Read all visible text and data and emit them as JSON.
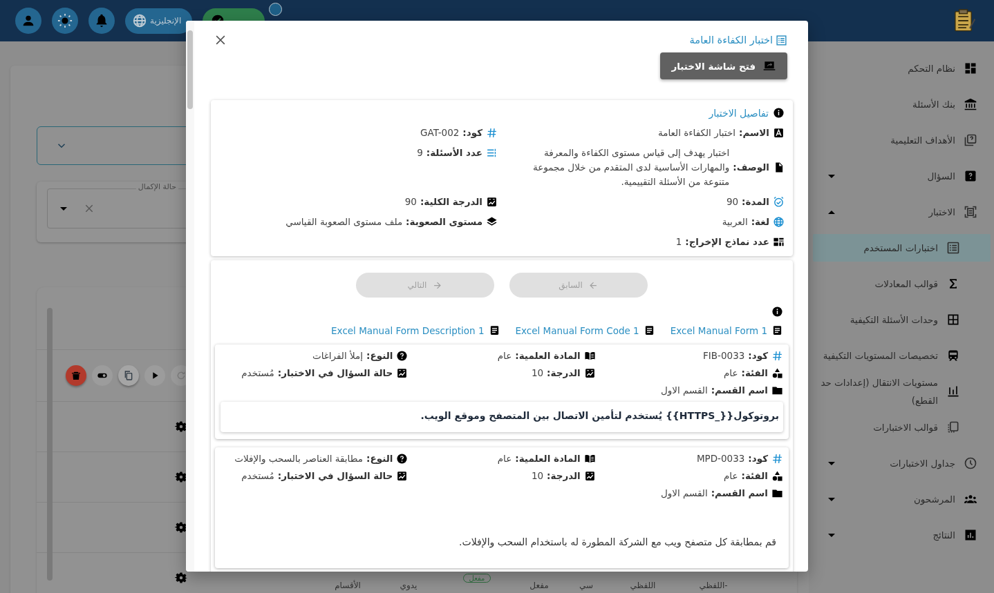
{
  "header": {
    "language": "الإنجليزية"
  },
  "sidebar": {
    "items": [
      {
        "label": "نظام التحكم",
        "selected": false
      },
      {
        "label": "بنك الأسئلة",
        "selected": false
      },
      {
        "label": "الأهداف التعليمية",
        "selected": false
      },
      {
        "label": "السؤال",
        "selected": false,
        "expanded": false
      },
      {
        "label": "الاختبار",
        "selected": false,
        "expanded": true,
        "children": [
          {
            "label": "اختبارات المستخدم",
            "selected": true
          },
          {
            "label": "قوالب المعادلات",
            "selected": false
          },
          {
            "label": "وحدات الأسئلة التكيفية",
            "selected": false
          },
          {
            "label": "تخصيصات المستويات التكيفية",
            "selected": false
          },
          {
            "label": "مستويات الانتقال (إعدادات حد القطع)",
            "selected": false
          },
          {
            "label": "قوالب الاختبارات",
            "selected": false
          }
        ]
      },
      {
        "label": "جداول الاختبارات",
        "selected": false,
        "expanded": false
      },
      {
        "label": "المرشحون",
        "selected": false,
        "expanded": false
      },
      {
        "label": "النتائج",
        "selected": false,
        "expanded": false
      }
    ]
  },
  "background": {
    "filter_label": "حالة الإكمال",
    "table_bottom_row": [
      "-اللفظي",
      "اللفظي",
      "سي",
      "مفعل",
      "مفعل",
      "يدوي",
      "الأقسام"
    ]
  },
  "dialog": {
    "title": "اختبار الكفاءة العامة",
    "open_button": "فتح شاشة الاختبار",
    "details": {
      "heading": "تفاصيل الاختبار",
      "fields": [
        {
          "label": "الاسم:",
          "value": "اختبار الكفاءة العامة"
        },
        {
          "label": "كود:",
          "value": "GAT-002"
        },
        {
          "label": "الوصف:",
          "value": "اختبار يهدف إلى قياس مستوى الكفاءة والمعرفة والمهارات الأساسية لدى المتقدم من خلال مجموعة متنوعة من الأسئلة التقييمية."
        },
        {
          "label": "عدد الأسئلة:",
          "value": "9"
        },
        {
          "label": "المدة:",
          "value": "90"
        },
        {
          "label": "الدرجة الكلية:",
          "value": "90"
        },
        {
          "label": "لغة:",
          "value": "العربية"
        },
        {
          "label": "مستوى الصعوبة:",
          "value": "ملف مستوى الصعوبة القياسي"
        },
        {
          "label": "عدد نماذج الإخراج:",
          "value": "1"
        }
      ]
    },
    "pager": [
      {
        "label": "السابق",
        "disabled": true
      },
      {
        "label": "التالي",
        "disabled": true
      }
    ],
    "forms": [
      "Excel Manual Form 1",
      "Excel Manual Form Code 1",
      "Excel Manual Form Description 1"
    ],
    "questions": [
      {
        "kind": "boxed",
        "fields": [
          {
            "label": "كود:",
            "value": "FIB-0033"
          },
          {
            "label": "المادة العلمية:",
            "value": "عام"
          },
          {
            "label": "النوع:",
            "value": "إملأ الفراغات"
          },
          {
            "label": "الفئة:",
            "value": "عام"
          },
          {
            "label": "الدرجة:",
            "value": "10"
          },
          {
            "label": "حالة السؤال في الاختبار:",
            "value": "مُستخدم"
          },
          {
            "label": "اسم القسم:",
            "value": "القسم الاول"
          }
        ],
        "text": "بروتوكول{{_HTTPS}} يُستخدم لتأمين الاتصال بين المتصفح وموقع الويب."
      },
      {
        "kind": "plain",
        "fields": [
          {
            "label": "كود:",
            "value": "MPD-0033"
          },
          {
            "label": "المادة العلمية:",
            "value": "عام"
          },
          {
            "label": "النوع:",
            "value": "مطابقة العناصر بالسحب والإفلات"
          },
          {
            "label": "الفئة:",
            "value": "عام"
          },
          {
            "label": "الدرجة:",
            "value": "10"
          },
          {
            "label": "حالة السؤال في الاختبار:",
            "value": "مُستخدم"
          },
          {
            "label": "اسم القسم:",
            "value": "القسم الاول"
          }
        ],
        "text": "قم بمطابقة كل متصفح ويب مع الشركة المطورة له باستخدام السحب والإفلات."
      }
    ]
  }
}
